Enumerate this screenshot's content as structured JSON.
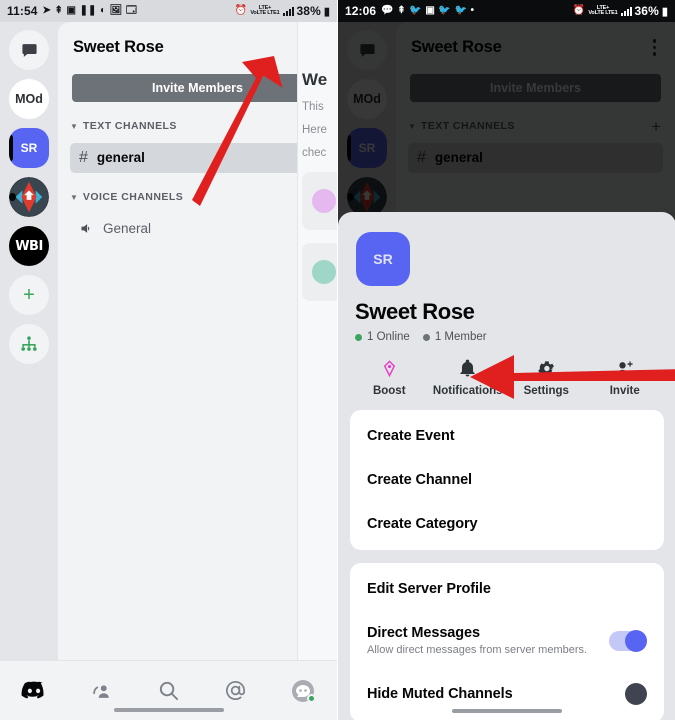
{
  "left": {
    "status": {
      "time": "11:54",
      "network": "VoLTE LTE1",
      "signal_label": "LTE+",
      "battery": "38%"
    },
    "server_rail": [
      {
        "name": "direct-messages",
        "label": "",
        "icon": "chat-bubble-icon",
        "style": "plain"
      },
      {
        "name": "server-mod",
        "label": "MOd",
        "style": "white"
      },
      {
        "name": "server-sweet-rose",
        "label": "SR",
        "style": "selected"
      },
      {
        "name": "server-home-emblem",
        "label": "",
        "icon": "house-emblem-icon",
        "style": "image"
      },
      {
        "name": "server-wbi",
        "label": "WBI",
        "style": "black"
      },
      {
        "name": "add-server",
        "label": "+",
        "style": "green"
      },
      {
        "name": "explore-servers",
        "label": "",
        "icon": "explore-compass-icon",
        "style": "green"
      }
    ],
    "header": {
      "title": "Sweet Rose",
      "menu_icon": "kebab-menu-icon"
    },
    "invite_button": "Invite Members",
    "sections": [
      {
        "label": "TEXT CHANNELS",
        "add_label": "+",
        "channels": [
          {
            "name": "general",
            "type": "text",
            "active": true
          }
        ]
      },
      {
        "label": "VOICE CHANNELS",
        "add_label": "+",
        "channels": [
          {
            "name": "General",
            "type": "voice",
            "active": false
          }
        ]
      }
    ],
    "chat_peek": {
      "heading": "We",
      "line1": "This",
      "line2": "Here",
      "line3": "chec"
    },
    "tabbar": [
      {
        "name": "tab-servers",
        "icon": "discord-logo-icon"
      },
      {
        "name": "tab-friends",
        "icon": "friends-icon"
      },
      {
        "name": "tab-search",
        "icon": "search-icon"
      },
      {
        "name": "tab-mentions",
        "icon": "at-mention-icon"
      },
      {
        "name": "tab-profile",
        "icon": "avatar-icon"
      }
    ]
  },
  "right": {
    "status": {
      "time": "12:06",
      "network": "VoLTE LTE1",
      "signal_label": "LTE+",
      "battery": "36%"
    },
    "behind": {
      "header_title": "Sweet Rose",
      "invite_button": "Invite Members",
      "section_label": "TEXT CHANNELS",
      "add_label": "+",
      "channel": "general"
    },
    "sheet": {
      "avatar_initials": "SR",
      "server_name": "Sweet Rose",
      "online_label": "1 Online",
      "members_label": "1 Member",
      "actions": [
        {
          "label": "Boost",
          "icon": "boost-diamond-icon"
        },
        {
          "label": "Notifications",
          "icon": "bell-icon"
        },
        {
          "label": "Settings",
          "icon": "gear-icon"
        },
        {
          "label": "Invite",
          "icon": "add-person-icon"
        }
      ],
      "create_menu": [
        {
          "label": "Create Event"
        },
        {
          "label": "Create Channel"
        },
        {
          "label": "Create Category"
        }
      ],
      "settings_menu": [
        {
          "label": "Edit Server Profile",
          "type": "link"
        },
        {
          "label": "Direct Messages",
          "sub": "Allow direct messages from server members.",
          "type": "toggle",
          "value": "on"
        },
        {
          "label": "Hide Muted Channels",
          "type": "toggle",
          "value": "off"
        }
      ]
    }
  },
  "annotations": [
    {
      "name": "arrow-to-kebab-menu",
      "color": "#e01f1f"
    },
    {
      "name": "arrow-to-create-category",
      "color": "#e01f1f"
    }
  ],
  "colors": {
    "accent": "#5865f2",
    "online": "#3ba55d",
    "arrow": "#e01f1f",
    "sidebar_bg": "#f2f3f5",
    "rail_bg": "#e3e5e8"
  }
}
